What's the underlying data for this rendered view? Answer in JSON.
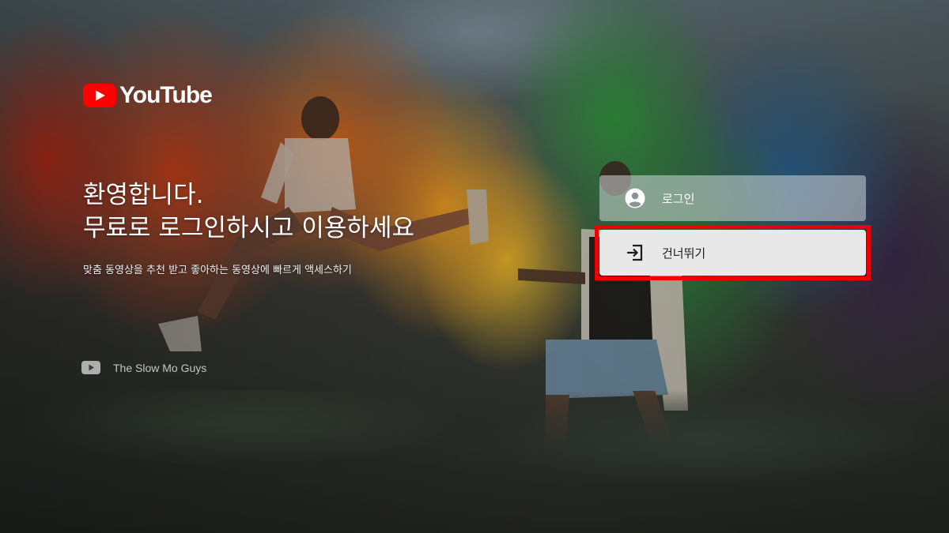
{
  "app": {
    "logo_text": "YouTube",
    "brand_color": "#ff0000"
  },
  "welcome": {
    "headline_line1": "환영합니다.",
    "headline_line2": "무료로 로그인하시고 이용하세요",
    "description": "맞춤 동영상을 추천 받고 좋아하는 동영상에 빠르게 액세스하기"
  },
  "credit": {
    "icon": "youtube-play-icon",
    "channel": "The Slow Mo Guys"
  },
  "actions": {
    "login_label": "로그인",
    "login_icon": "account-circle-icon",
    "skip_label": "건너뛰기",
    "skip_icon": "exit-arrow-icon",
    "focused": "skip",
    "focus_color": "#ee0000"
  }
}
